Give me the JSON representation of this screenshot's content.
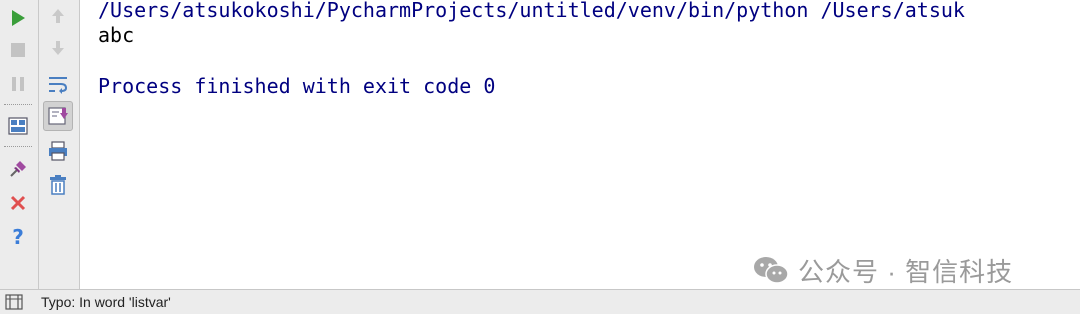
{
  "console": {
    "command_line": "/Users/atsukokoshi/PycharmProjects/untitled/venv/bin/python /Users/atsuk",
    "output_line": "abc",
    "exit_line": "Process finished with exit code 0",
    "command_color": "#000080",
    "output_color": "#000000"
  },
  "left_toolbar": {
    "items": [
      {
        "icon": "run-icon",
        "color": "#3a9e3a"
      },
      {
        "icon": "stop-icon",
        "color": "#bdbdbd"
      },
      {
        "icon": "pause-icon",
        "color": "#bdbdbd"
      },
      {
        "icon": "layout-icon"
      },
      {
        "icon": "pin-icon"
      },
      {
        "icon": "close-icon",
        "color": "#e05050"
      },
      {
        "icon": "help-icon",
        "color": "#3b7dd8"
      }
    ]
  },
  "second_toolbar": {
    "items": [
      {
        "icon": "up-arrow-icon"
      },
      {
        "icon": "down-arrow-icon"
      },
      {
        "icon": "soft-wrap-icon"
      },
      {
        "icon": "scroll-to-end-icon",
        "pressed": true
      },
      {
        "icon": "print-icon"
      },
      {
        "icon": "trash-icon"
      }
    ]
  },
  "status_bar": {
    "text": "Typo: In word 'listvar'"
  },
  "watermark": {
    "text": "公众号 · 智信科技"
  }
}
